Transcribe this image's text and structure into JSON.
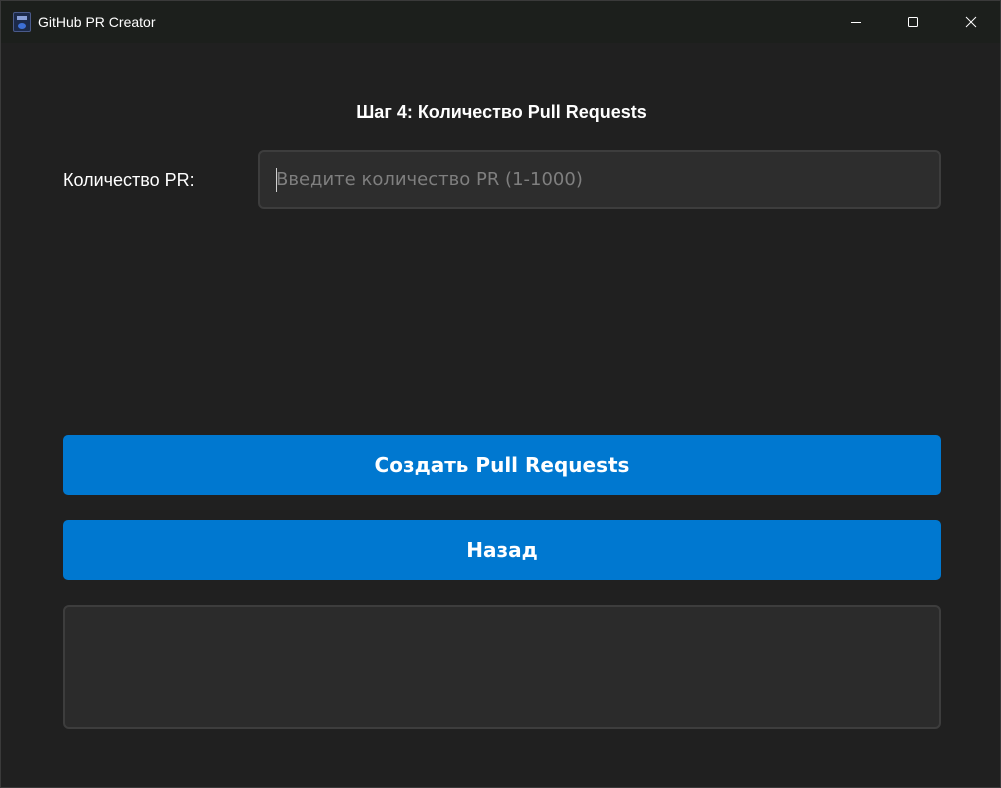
{
  "window": {
    "title": "GitHub PR Creator",
    "icon": "app-logo-icon",
    "controls": [
      "minimize-icon",
      "maximize-icon",
      "close-icon"
    ]
  },
  "step": {
    "heading": "Шаг 4: Количество Pull Requests"
  },
  "form": {
    "count_label": "Количество PR:",
    "count_value": "",
    "count_placeholder": "Введите количество PR (1-1000)"
  },
  "actions": {
    "create_label": "Создать Pull Requests",
    "back_label": "Назад"
  },
  "log": {
    "text": ""
  },
  "colors": {
    "background": "#202020",
    "titlebar": "#1c1f1c",
    "accent": "#0078d0",
    "input_bg": "#2d2d2d",
    "text": "#ffffff"
  }
}
